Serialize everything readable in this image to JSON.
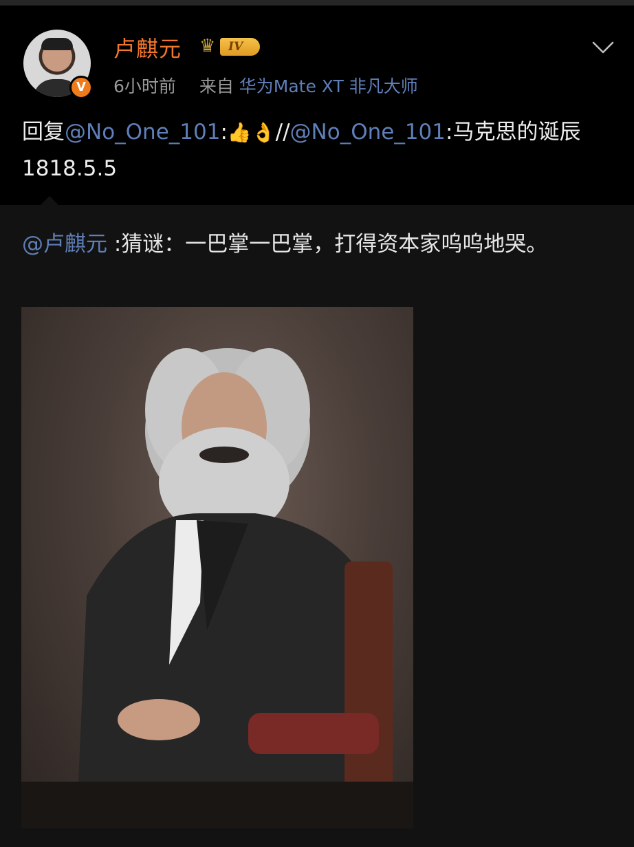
{
  "post": {
    "username": "卢麒元",
    "level_badge": "IV",
    "verified_badge": "V",
    "time": "6小时前",
    "source_prefix": "来自",
    "device": "华为Mate XT 非凡大师",
    "reply_prefix": "回复",
    "reply_mention": "@No_One_101",
    "reply_colon": ":",
    "emoji_1": "👍",
    "emoji_2": "👌",
    "slashes": "//",
    "quoted_mention": "@No_One_101",
    "quoted_text": ":马克思的诞辰1818.5.5"
  },
  "repost": {
    "mention": "@卢麒元",
    "text": " :猜谜：一巴掌一巴掌，打得资本家呜呜地哭。"
  },
  "colors": {
    "username": "#f1772c",
    "link": "#5f7fb8",
    "background": "#000000",
    "repost_background": "#121212"
  },
  "icons": {
    "menu": "chevron-down-icon",
    "level": "crown-icon",
    "verified": "verified-v-icon"
  }
}
